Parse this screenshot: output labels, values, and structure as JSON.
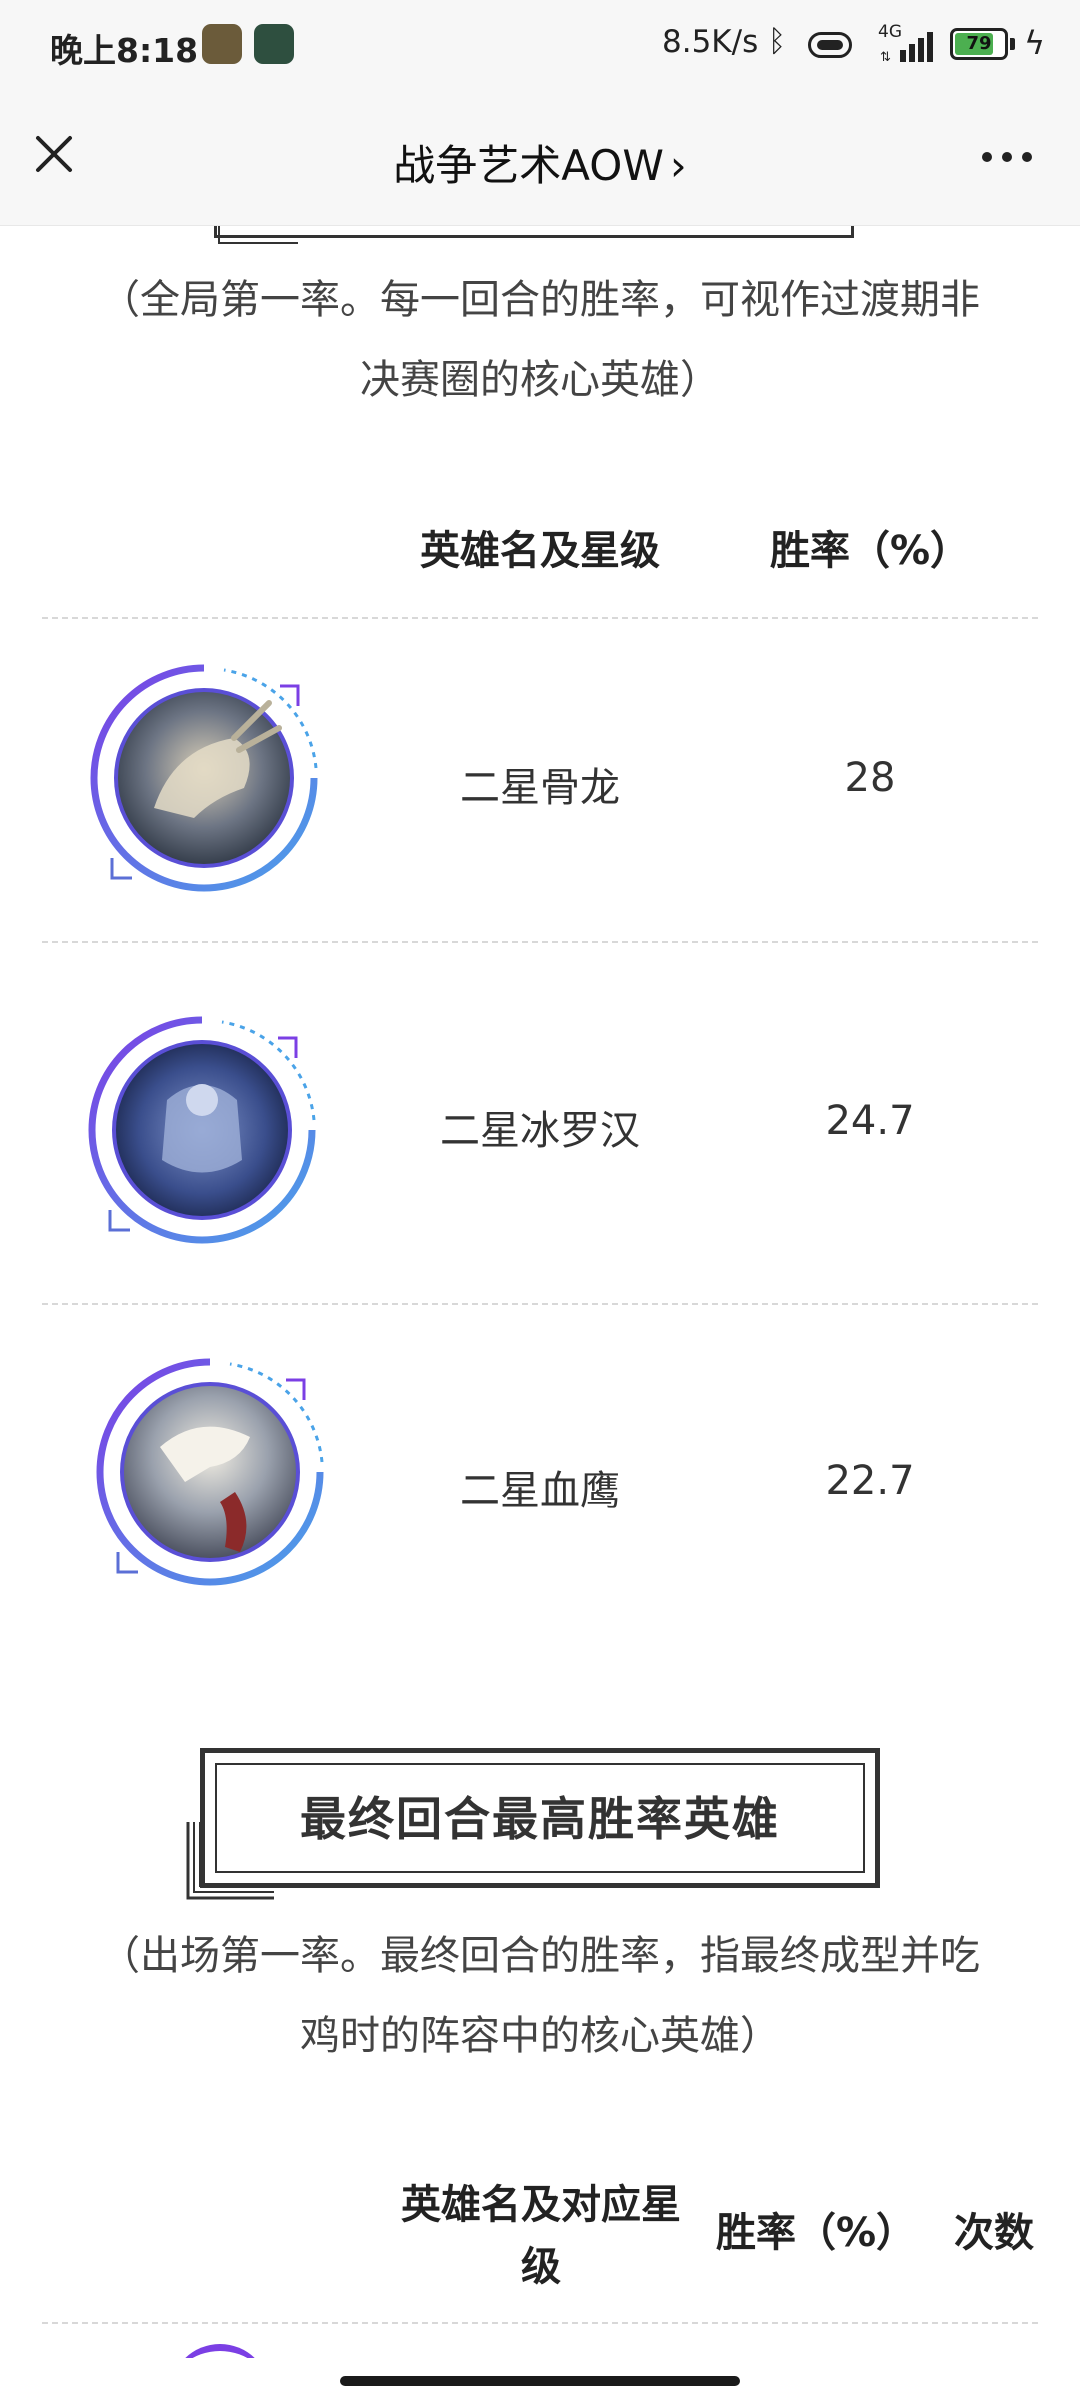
{
  "status_bar": {
    "time": "晚上8:18",
    "speed": "8.5K/s",
    "network": "4G",
    "battery": "79",
    "icons": [
      "bluetooth-icon",
      "vibrate-icon",
      "signal-icon",
      "charging-icon"
    ]
  },
  "nav": {
    "title": "战争艺术AOW",
    "title_chevron": "›",
    "close_icon": "close-icon",
    "more_icon": "more-icon"
  },
  "section1": {
    "intro_line1": "（全局第一率。每一回合的胜率，可视作过渡期非",
    "intro_line2": "决赛圈的核心英雄）",
    "headers": {
      "name": "英雄名及星级",
      "rate": "胜率（%）"
    },
    "rows": [
      {
        "name": "二星骨龙",
        "rate": "28"
      },
      {
        "name": "二星冰罗汉",
        "rate": "24.7"
      },
      {
        "name": "二星血鹰",
        "rate": "22.7"
      }
    ]
  },
  "section2": {
    "title": "最终回合最高胜率英雄",
    "intro_line1": "（出场第一率。最终回合的胜率，指最终成型并吃",
    "intro_line2": "鸡时的阵容中的核心英雄）",
    "headers": {
      "name_line1": "英雄名及对应星",
      "name_line2": "级",
      "rate": "胜率（%）",
      "count": "次数"
    }
  },
  "colors": {
    "ring_purple": "#7b3fe4",
    "ring_blue": "#4aa3e8",
    "battery_green": "#4caf50"
  }
}
